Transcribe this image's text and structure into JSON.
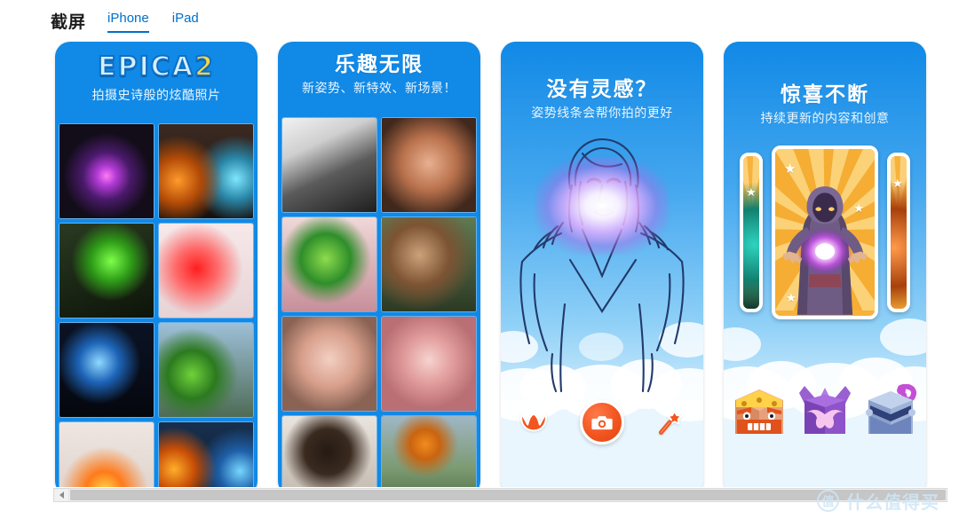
{
  "header": {
    "title": "截屏",
    "tabs": [
      {
        "label": "iPhone",
        "active": true
      },
      {
        "label": "iPad",
        "active": false
      }
    ]
  },
  "screenshots": [
    {
      "name": "epica-logo-shot",
      "logo_text": "EPICA",
      "logo_suffix": "2",
      "title": "",
      "subtitle": "拍摄史诗般的炫酷照片",
      "layout": "photo-grid",
      "photos": [
        "hooded-figure-purple-magic",
        "girl-fire-and-ice-hands",
        "green-slime-face",
        "girl-red-smoke-potion",
        "blue-lightning-portrait",
        "crocodile-head-group",
        "woman-fire-breath",
        "man-fire-ice-wings"
      ]
    },
    {
      "name": "fun-unlimited-shot",
      "logo_text": "",
      "logo_suffix": "",
      "title": "乐趣无限",
      "subtitle": "新姿势、新特效、新场景！",
      "layout": "photo-grid",
      "photos": [
        "bw-tiger-face-jump",
        "gold-teeth-sunglasses-car",
        "monster-mask-girl",
        "deer-head-roar-man",
        "glitter-skin-woman",
        "pink-eye-mask-tongue",
        "afro-hair-man",
        "carrot-nose-rabbit"
      ]
    },
    {
      "name": "no-inspiration-shot",
      "logo_text": "",
      "logo_suffix": "",
      "title": "没有灵感？",
      "subtitle": "姿势线条会帮你拍的更好",
      "layout": "pose-guide",
      "pose_art": "magic-pose-outline",
      "toolbar": {
        "left_icon": "devil-horns-icon",
        "capture_label": "camera-shutter-button",
        "right_icon": "magic-wand-icon"
      }
    },
    {
      "name": "surprises-shot",
      "logo_text": "",
      "logo_suffix": "",
      "title": "惊喜不断",
      "subtitle": "持续更新的内容和创意",
      "layout": "card-carousel",
      "cards": [
        "sunburst-card-left",
        "sunburst-card-mage",
        "sunburst-card-right"
      ],
      "sticker_boxes": [
        "viking-king-box",
        "purple-mustache-box",
        "knight-helmet-box"
      ]
    }
  ],
  "scrollbar": {
    "arrow_icon": "chevron-left-icon",
    "thumb_label": "horizontal-scroll-thumb"
  },
  "watermark": {
    "logo_char": "值",
    "text": "什么值得买"
  },
  "colors": {
    "brand_blue": "#1189e6",
    "link_blue": "#0070c9",
    "accent_orange": "#f2551f",
    "card_yellow": "#f7b23b"
  }
}
